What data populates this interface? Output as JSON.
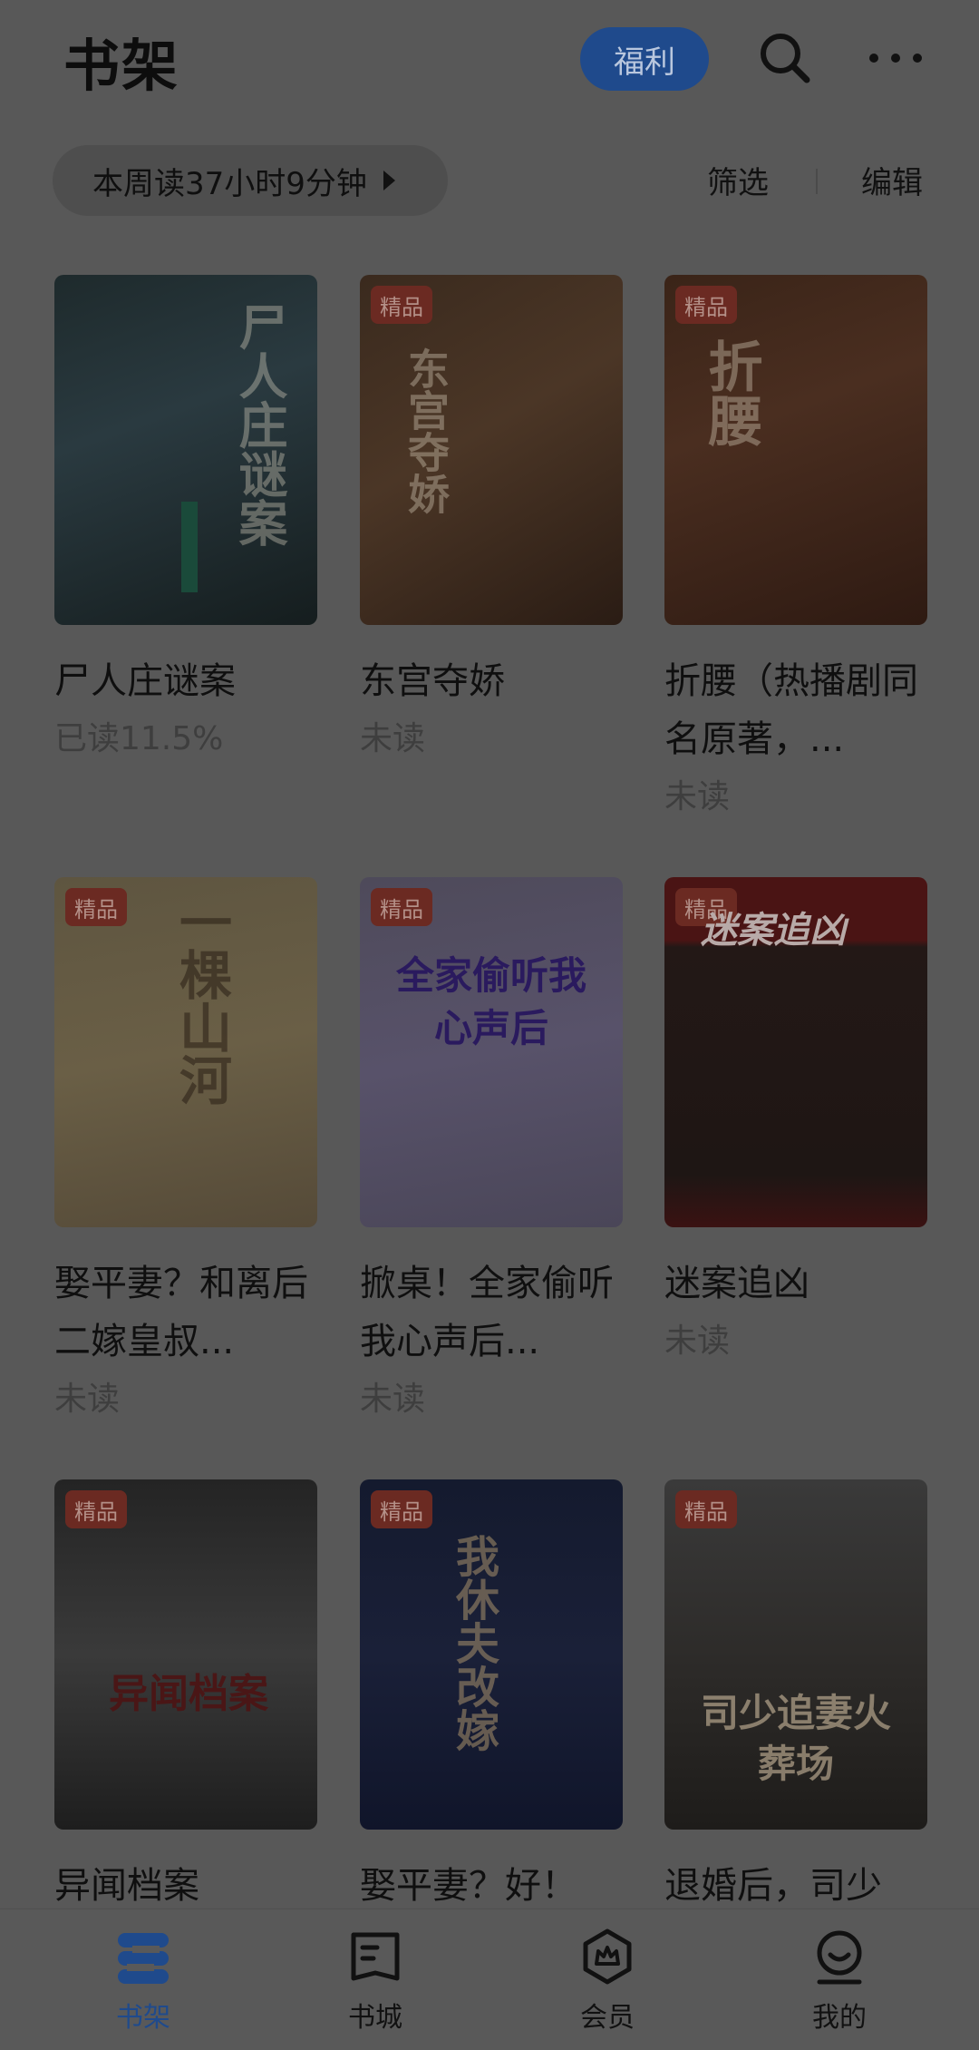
{
  "header": {
    "title": "书架",
    "welfare_label": "福利",
    "search_icon": "search-icon",
    "more_icon": "more-icon"
  },
  "stats": {
    "reading_time": "本周读37小时9分钟"
  },
  "toolbar": {
    "filter_label": "筛选",
    "edit_label": "编辑"
  },
  "books": [
    {
      "title": "尸人庄谜案",
      "status": "已读11.5%",
      "badge": "",
      "cover_text": "尸人庄谜案"
    },
    {
      "title": "东宫夺娇",
      "status": "未读",
      "badge": "精品",
      "cover_text": "东宫夺娇"
    },
    {
      "title": "折腰（热播剧同名原著，...",
      "status": "未读",
      "badge": "精品",
      "cover_text": "折腰"
    },
    {
      "title": "娶平妻？和离后二嫁皇叔...",
      "status": "未读",
      "badge": "精品",
      "cover_text": "一棵山河"
    },
    {
      "title": "掀桌！全家偷听我心声后...",
      "status": "未读",
      "badge": "精品",
      "cover_text": "全家偷听我心声后"
    },
    {
      "title": "迷案追凶",
      "status": "未读",
      "badge": "精品",
      "cover_text": "迷案追凶"
    },
    {
      "title": "异闻档案",
      "status": "",
      "badge": "精品",
      "cover_text": "异闻档案"
    },
    {
      "title": "娶平妻？好！",
      "status": "",
      "badge": "精品",
      "cover_text": "我休夫改嫁"
    },
    {
      "title": "退婚后，司少",
      "status": "",
      "badge": "精品",
      "cover_text": "司少追妻火葬场"
    }
  ],
  "nav": {
    "items": [
      {
        "label": "书架",
        "icon": "bookshelf-icon",
        "active": true
      },
      {
        "label": "书城",
        "icon": "bookstore-icon",
        "active": false
      },
      {
        "label": "会员",
        "icon": "membership-icon",
        "active": false
      },
      {
        "label": "我的",
        "icon": "profile-icon",
        "active": false
      }
    ]
  },
  "colors": {
    "accent": "#1f4a8c",
    "badge": "#6b2a22",
    "overlay_bg": "#585858"
  }
}
